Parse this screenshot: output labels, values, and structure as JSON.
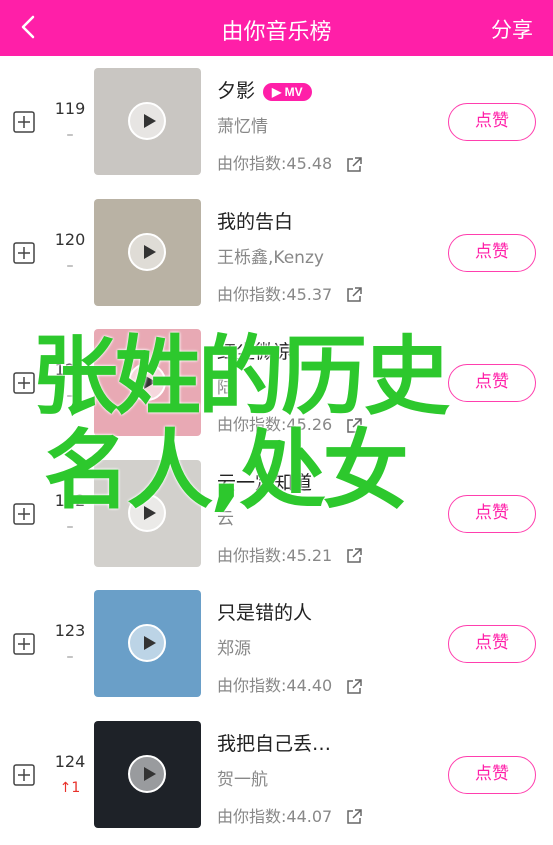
{
  "header": {
    "back_icon": "chevron-left-icon",
    "title": "由你音乐榜",
    "share_label": "分享",
    "bg_color": "#ff1fa8"
  },
  "songs": [
    {
      "rank": "119",
      "change": "–",
      "change_dir": "none",
      "title": "夕影",
      "mv": "MV",
      "singer": "萧忆情",
      "index": "由你指数:45.48",
      "like": "点赞",
      "cover_color": "#c9c6c2"
    },
    {
      "rank": "120",
      "change": "–",
      "change_dir": "none",
      "title": "我的告白",
      "mv": "",
      "singer": "王栎鑫,Kenzy",
      "index": "由你指数:45.37",
      "like": "点赞",
      "cover_color": "#b9b2a4"
    },
    {
      "rank": "121",
      "change": "–",
      "change_dir": "none",
      "title": "红尘微凉",
      "mv": "",
      "singer": "陆",
      "index": "由你指数:45.26",
      "like": "点赞",
      "cover_color": "#e8a9b4"
    },
    {
      "rank": "122",
      "change": "–",
      "change_dir": "none",
      "title": "云一定知道",
      "mv": "",
      "singer": "云",
      "index": "由你指数:45.21",
      "like": "点赞",
      "cover_color": "#d2d0cc"
    },
    {
      "rank": "123",
      "change": "–",
      "change_dir": "none",
      "title": "只是错的人",
      "mv": "",
      "singer": "郑源",
      "index": "由你指数:44.40",
      "like": "点赞",
      "cover_color": "#6a9fc8"
    },
    {
      "rank": "124",
      "change": "1",
      "change_dir": "up",
      "title": "我把自己丢…",
      "mv": "",
      "singer": "贺一航",
      "index": "由你指数:44.07",
      "like": "点赞",
      "cover_color": "#1e2228"
    }
  ],
  "overlay": {
    "line1": "张姓的历史",
    "line2": "名人,处女",
    "color": "#2dc82d"
  },
  "accent_color": "#ff1fa8"
}
